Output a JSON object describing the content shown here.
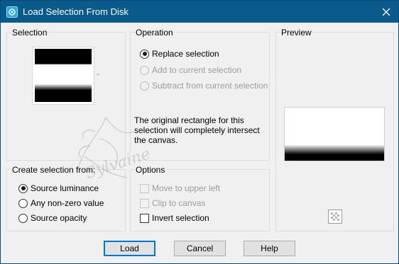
{
  "window": {
    "title": "Load Selection From Disk",
    "icon": "app-icon",
    "close_icon": "close-icon"
  },
  "selection": {
    "label": "Selection"
  },
  "operation": {
    "label": "Operation",
    "options": [
      {
        "label": "Replace selection",
        "checked": true,
        "disabled": false
      },
      {
        "label": "Add to current selection",
        "checked": false,
        "disabled": true
      },
      {
        "label": "Subtract from current selection",
        "checked": false,
        "disabled": true
      }
    ],
    "info": "The original rectangle for this selection will completely intersect the canvas."
  },
  "preview": {
    "label": "Preview",
    "checker_icon": "checkerboard-icon"
  },
  "create_from": {
    "label": "Create selection from:",
    "options": [
      {
        "label": "Source luminance",
        "checked": true
      },
      {
        "label": "Any non-zero value",
        "checked": false
      },
      {
        "label": "Source opacity",
        "checked": false
      }
    ]
  },
  "options": {
    "label": "Options",
    "items": [
      {
        "label": "Move to upper left",
        "checked": false,
        "disabled": true
      },
      {
        "label": "Clip to canvas",
        "checked": false,
        "disabled": true
      },
      {
        "label": "Invert selection",
        "checked": false,
        "disabled": false
      }
    ]
  },
  "buttons": {
    "load": "Load",
    "cancel": "Cancel",
    "help": "Help"
  },
  "watermark": {
    "text": "Sylvaine"
  },
  "colors": {
    "titlebar": "#0b5a8c",
    "dialog": "#f0f0f0",
    "accent": "#0078d7"
  }
}
